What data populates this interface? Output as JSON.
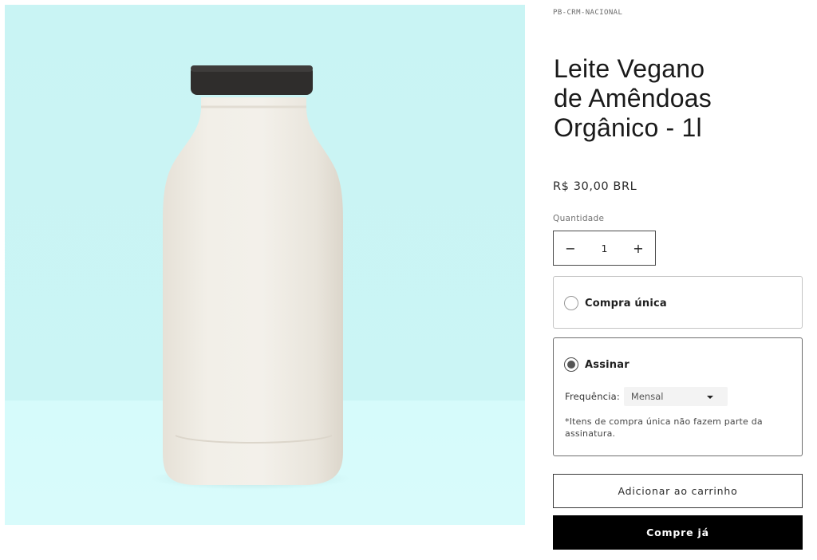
{
  "product": {
    "sku": "PB-CRM-NACIONAL",
    "title_lines": [
      "Leite Vegano",
      "de Amêndoas",
      "Orgânico - 1l"
    ],
    "price": "R$ 30,00 BRL",
    "image_icon": "milk-bottle-image"
  },
  "quantity": {
    "label": "Quantidade",
    "value": "1",
    "decrement_symbol": "−",
    "increment_symbol": "+"
  },
  "purchase_options": {
    "one_time": {
      "label": "Compra única",
      "selected": false
    },
    "subscription": {
      "label": "Assinar",
      "selected": true,
      "frequency_label": "Frequência:",
      "frequency_value": "Mensal",
      "note": "*Itens de compra única não fazem parte da assinatura."
    }
  },
  "actions": {
    "add_to_cart": "Adicionar ao carrinho",
    "buy_now": "Compre já"
  },
  "colors": {
    "background_image": "#cbf5f5",
    "buy_button": "#000000",
    "border": "#c4c4c4"
  }
}
